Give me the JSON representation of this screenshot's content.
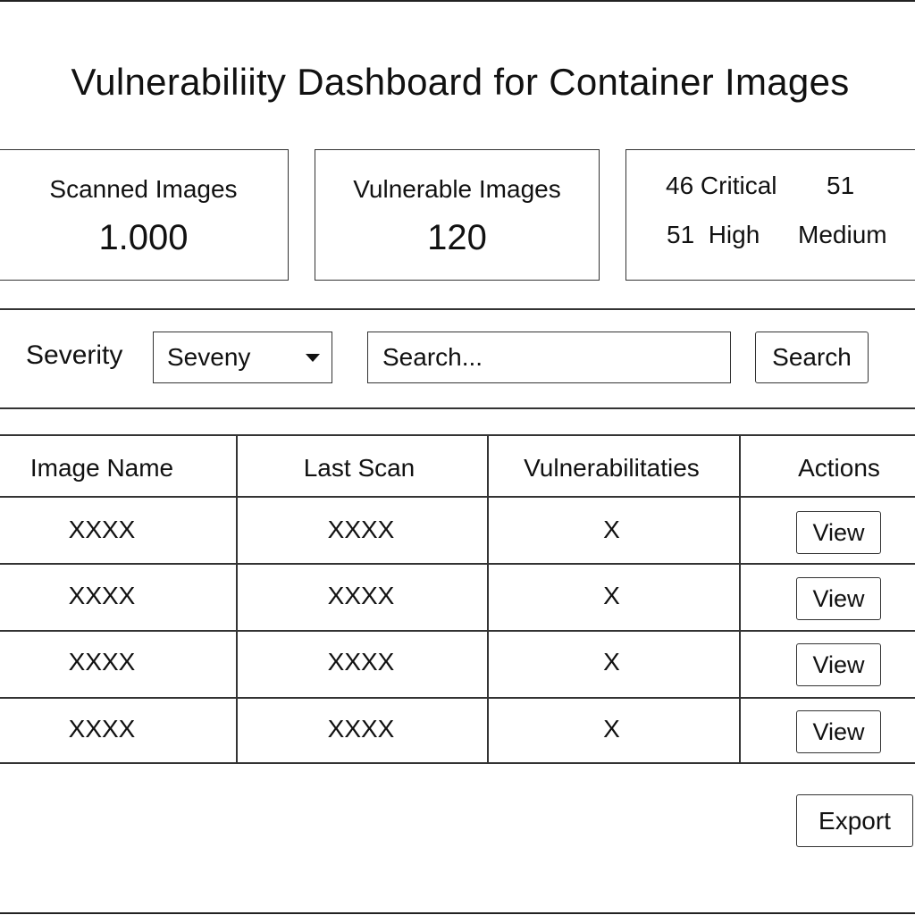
{
  "header": {
    "title": "Vulnerabiliity Dashboard for Container Images"
  },
  "stats": {
    "scanned": {
      "label": "Scanned Images",
      "value": "1.000"
    },
    "vulnerable": {
      "label": "Vulnerable Images",
      "value": "120"
    },
    "severity": {
      "critical": "46 Critical",
      "medium_count": "51",
      "high": "51  High",
      "medium_label": "Medium"
    }
  },
  "filters": {
    "severity_label": "Severity",
    "severity_select_value": "Seveny",
    "search_placeholder": "Search...",
    "search_button": "Search"
  },
  "table": {
    "columns": [
      "Image Name",
      "Last Scan",
      "Vulnerabilitaties",
      "Actions"
    ],
    "rows": [
      {
        "image_name": "XXXX",
        "last_scan": "XXXX",
        "vulnerabilities": "X",
        "action": "View"
      },
      {
        "image_name": "XXXX",
        "last_scan": "XXXX",
        "vulnerabilities": "X",
        "action": "View"
      },
      {
        "image_name": "XXXX",
        "last_scan": "XXXX",
        "vulnerabilities": "X",
        "action": "View"
      },
      {
        "image_name": "XXXX",
        "last_scan": "XXXX",
        "vulnerabilities": "X",
        "action": "View"
      }
    ]
  },
  "footer": {
    "export_label": "Export"
  }
}
